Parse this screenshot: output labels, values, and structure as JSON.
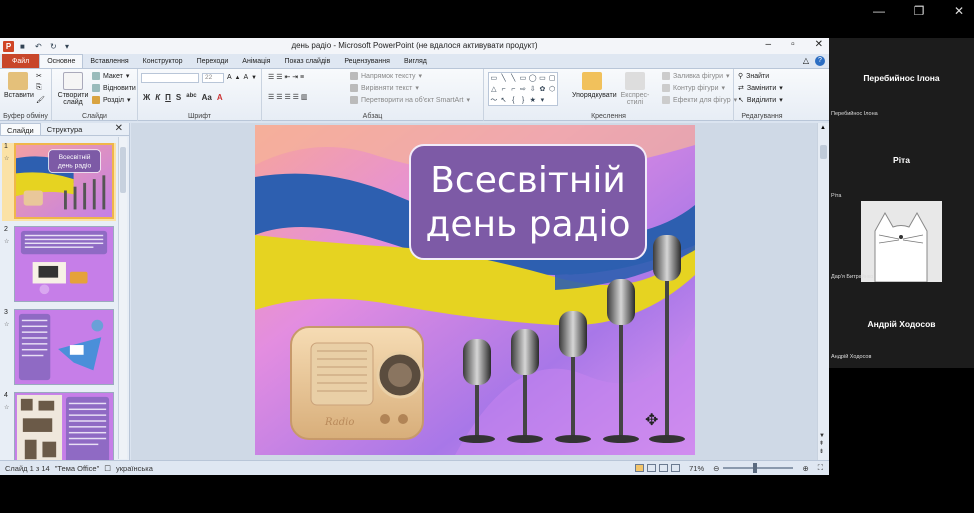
{
  "ppt": {
    "window_title": "день радіо - Microsoft PowerPoint (не вдалося активувати продукт)",
    "tabs": [
      "Файл",
      "Основне",
      "Вставлення",
      "Конструктор",
      "Переходи",
      "Анімація",
      "Показ слайдів",
      "Рецензування",
      "Вигляд"
    ],
    "active_tab_index": 1,
    "ribbon": {
      "clipboard": {
        "paste": "Вставити",
        "label": "Буфер обміну"
      },
      "slides": {
        "new_slide": "Створити слайд",
        "layout": "Макет",
        "reset": "Відновити",
        "section": "Розділ",
        "label": "Слайди"
      },
      "font": {
        "size": "22",
        "label": "Шрифт"
      },
      "paragraph": {
        "direction": "Напрямок тексту",
        "align": "Вирівняти текст",
        "smartart": "Перетворити на об'єкт SmartArt",
        "label": "Абзац"
      },
      "drawing": {
        "arrange": "Упорядкувати",
        "styles": "Експрес-стилі",
        "fill": "Заливка фігури",
        "outline": "Контур фігури",
        "effects": "Ефекти для фігур",
        "label": "Креслення"
      },
      "editing": {
        "find": "Знайти",
        "replace": "Замінити",
        "select": "Виділити",
        "label": "Редагування"
      }
    },
    "left_panel": {
      "tab_slides": "Слайди",
      "tab_outline": "Структура",
      "thumbnails": [
        "1",
        "2",
        "3",
        "4"
      ]
    },
    "slide": {
      "title_line1": "Всесвітній",
      "title_line2": "день радіо",
      "radio_brand": "Radio"
    },
    "status": {
      "slide_info": "Слайд 1 з 14",
      "theme": "\"Тема Office\"",
      "language": "українська",
      "zoom": "71%"
    }
  },
  "participants": [
    {
      "name": "Перебийнос Ілона",
      "small": "Перебийнос Ілона"
    },
    {
      "name": "Рiта",
      "small": "Рiта"
    },
    {
      "name": "",
      "small": "Дар'я Битрайнко"
    },
    {
      "name": "Андрій Ходосов",
      "small": "Андрій Ходосов"
    }
  ],
  "colors": {
    "slide_title_bg": "#7d5aa6",
    "file_tab": "#c8462a",
    "ukraine_blue": "#2d5fb0",
    "ukraine_yellow": "#e6d321"
  }
}
